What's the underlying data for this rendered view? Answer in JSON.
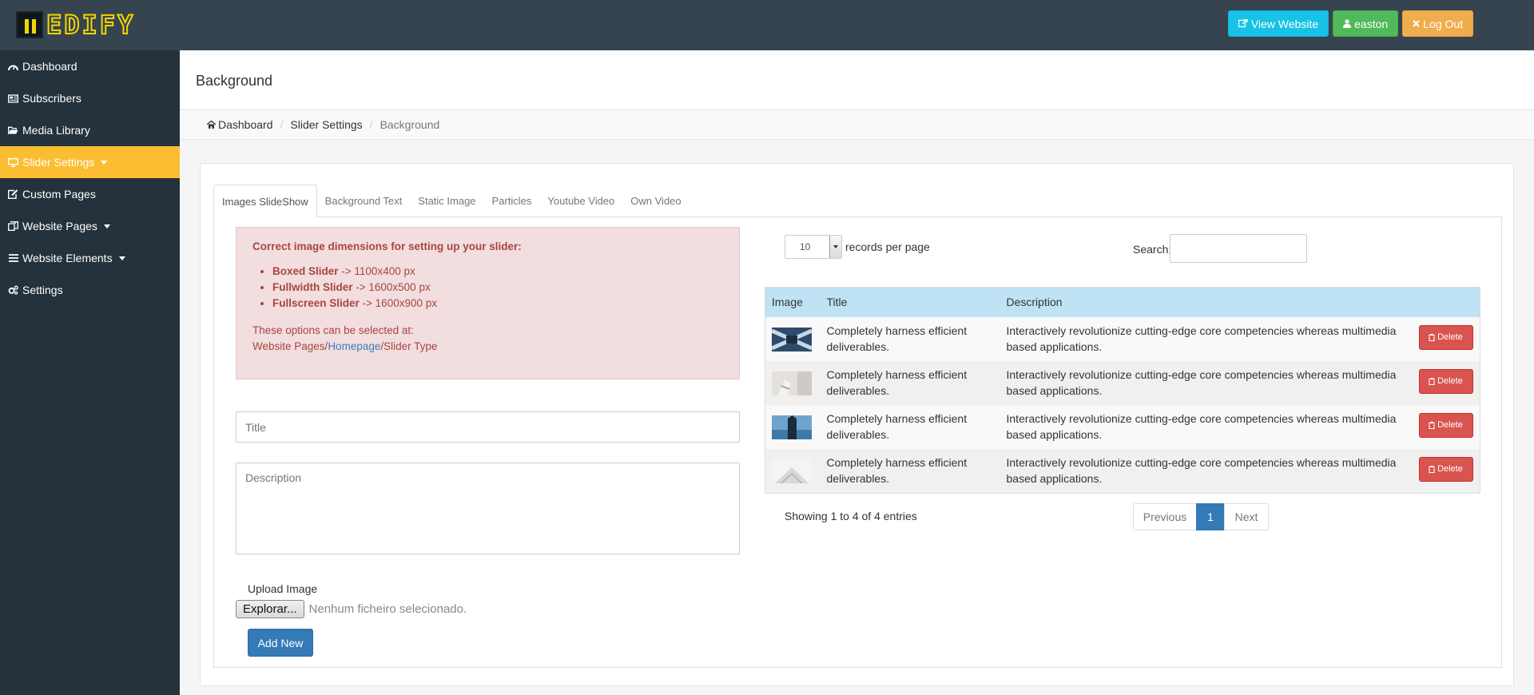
{
  "brand": {
    "logo_text": "EDIFY"
  },
  "topbar": {
    "view_website": "View Website",
    "user": "easton",
    "logout": "Log Out"
  },
  "sidebar": {
    "items": [
      {
        "label": "Dashboard",
        "icon": "dashboard-icon"
      },
      {
        "label": "Subscribers",
        "icon": "newspaper-icon"
      },
      {
        "label": "Media Library",
        "icon": "folder-open-icon"
      },
      {
        "label": "Slider Settings",
        "icon": "desktop-icon",
        "active": true
      },
      {
        "label": "Custom Pages",
        "icon": "edit-icon"
      },
      {
        "label": "Website Pages",
        "icon": "files-icon"
      },
      {
        "label": "Website Elements",
        "icon": "bars-icon"
      },
      {
        "label": "Settings",
        "icon": "cogs-icon"
      }
    ]
  },
  "page": {
    "title": "Background"
  },
  "breadcrumb": {
    "home": "Dashboard",
    "parent": "Slider Settings",
    "current": "Background"
  },
  "tabs": [
    "Images SlideShow",
    "Background Text",
    "Static Image",
    "Particles",
    "Youtube Video",
    "Own Video"
  ],
  "alert": {
    "heading": "Correct image dimensions for setting up your slider:",
    "items": [
      {
        "name": "Boxed Slider",
        "size": " -> 1100x400 px"
      },
      {
        "name": "Fullwidth Slider",
        "size": " -> 1600x500 px"
      },
      {
        "name": "Fullscreen Slider",
        "size": " -> 1600x900 px"
      }
    ],
    "note": "These options can be selected at:",
    "path_start": "Website Pages/",
    "path_link": "Homepage",
    "path_end": "/Slider Type"
  },
  "form": {
    "title_placeholder": "Title",
    "description_placeholder": "Description",
    "upload_label": "Upload Image",
    "browse_button": "Explorar...",
    "no_file": "Nenhum ficheiro selecionado.",
    "add_button": "Add New"
  },
  "datatable": {
    "length_value": "10",
    "length_label": "records per page",
    "search_label": "Search:",
    "columns": [
      "Image",
      "Title",
      "Description",
      ""
    ],
    "rows": [
      {
        "title": "Completely harness efficient deliverables.",
        "description": "Interactively revolutionize cutting-edge core competencies whereas multimedia based applications.",
        "delete": "Delete"
      },
      {
        "title": "Completely harness efficient deliverables.",
        "description": "Interactively revolutionize cutting-edge core competencies whereas multimedia based applications.",
        "delete": "Delete"
      },
      {
        "title": "Completely harness efficient deliverables.",
        "description": "Interactively revolutionize cutting-edge core competencies whereas multimedia based applications.",
        "delete": "Delete"
      },
      {
        "title": "Completely harness efficient deliverables.",
        "description": "Interactively revolutionize cutting-edge core competencies whereas multimedia based applications.",
        "delete": "Delete"
      }
    ],
    "info": "Showing 1 to 4 of 4 entries",
    "pager": {
      "previous": "Previous",
      "current": "1",
      "next": "Next"
    }
  },
  "colors": {
    "topbar": "#36444f",
    "sidebar": "#26323b",
    "sidebar_active": "#fbbe33",
    "primary": "#337ab7",
    "danger": "#d9534f",
    "info": "#17c2e6",
    "success": "#50b95a",
    "warning": "#f0ad4e"
  }
}
